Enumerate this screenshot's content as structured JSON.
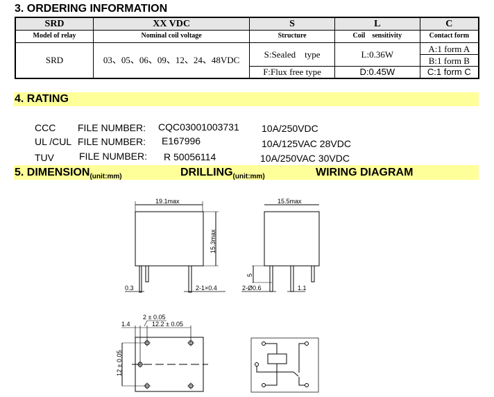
{
  "section3": {
    "title": "3. ORDERING INFORMATION",
    "table": {
      "header_codes": [
        "SRD",
        "XX VDC",
        "S",
        "L",
        "C"
      ],
      "header_labels": [
        "Model of relay",
        "Nominal coil voltage",
        "Structure",
        "Coil    sensitivity",
        "Contact form"
      ],
      "model": "SRD",
      "voltages": "03、05、06、09、12、24、48VDC",
      "structures": [
        "S:Sealed    type",
        "F:Flux free type"
      ],
      "sensitivities": [
        "L:0.36W",
        "D:0.45W"
      ],
      "contact_forms": [
        "A:1 form A",
        "B:1 form B",
        "C:1 form C"
      ]
    }
  },
  "section4": {
    "title": "4. RATING",
    "rows": [
      {
        "agency": "CCC",
        "label": "FILE NUMBER:",
        "file": "CQC03001003731",
        "rating": "10A/250VDC"
      },
      {
        "agency": "UL /CUL",
        "label": "FILE NUMBER:",
        "file": "E167996",
        "rating": "10A/125VAC 28VDC"
      },
      {
        "agency": "TUV",
        "label": "FILE NUMBER:",
        "file": "R 50056114",
        "rating": "10A/250VAC 30VDC"
      }
    ]
  },
  "section5": {
    "title_dimension": "5. DIMENSION",
    "unit_dimension": "(unit:mm)",
    "title_drilling": "DRILLING",
    "unit_drilling": "(unit:mm)",
    "title_wiring": "WIRING DIAGRAM",
    "front_view": {
      "width_label": "19.1max",
      "height_label": "15.3max",
      "pin_thickness": "0.3",
      "pin_width": "2-1×0.4"
    },
    "side_view": {
      "width_label": "15.5max",
      "pin_length": "5",
      "pin_diameter": "2-Ø0.6",
      "pin_width": "1.1"
    },
    "drilling": {
      "spacing_small": "2 ± 0.05",
      "offset": "1.4",
      "spacing_x": "12.2 ± 0.05",
      "spacing_y": "12 ± 0.05"
    }
  },
  "colors": {
    "section_highlight": "#ffff99",
    "table_header": "#e6e6e6"
  }
}
